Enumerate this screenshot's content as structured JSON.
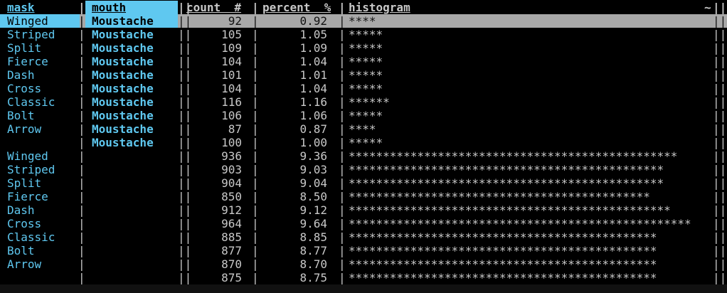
{
  "header": {
    "mask": "mask",
    "mouth": "mouth",
    "count": "count  #",
    "percent": "percent  %",
    "histogram": "histogram",
    "corner": "~"
  },
  "separator": "|",
  "rows": [
    {
      "mask": "Winged",
      "mouth": "Moustache",
      "count": "92",
      "percent": "0.92",
      "hist": "****"
    },
    {
      "mask": "Striped",
      "mouth": "Moustache",
      "count": "105",
      "percent": "1.05",
      "hist": "*****"
    },
    {
      "mask": "Split",
      "mouth": "Moustache",
      "count": "109",
      "percent": "1.09",
      "hist": "*****"
    },
    {
      "mask": "Fierce",
      "mouth": "Moustache",
      "count": "104",
      "percent": "1.04",
      "hist": "*****"
    },
    {
      "mask": "Dash",
      "mouth": "Moustache",
      "count": "101",
      "percent": "1.01",
      "hist": "*****"
    },
    {
      "mask": "Cross",
      "mouth": "Moustache",
      "count": "104",
      "percent": "1.04",
      "hist": "*****"
    },
    {
      "mask": "Classic",
      "mouth": "Moustache",
      "count": "116",
      "percent": "1.16",
      "hist": "******"
    },
    {
      "mask": "Bolt",
      "mouth": "Moustache",
      "count": "106",
      "percent": "1.06",
      "hist": "*****"
    },
    {
      "mask": "Arrow",
      "mouth": "Moustache",
      "count": "87",
      "percent": "0.87",
      "hist": "****"
    },
    {
      "mask": "",
      "mouth": "Moustache",
      "count": "100",
      "percent": "1.00",
      "hist": "*****"
    },
    {
      "mask": "Winged",
      "mouth": "",
      "count": "936",
      "percent": "9.36",
      "hist": "************************************************"
    },
    {
      "mask": "Striped",
      "mouth": "",
      "count": "903",
      "percent": "9.03",
      "hist": "**********************************************"
    },
    {
      "mask": "Split",
      "mouth": "",
      "count": "904",
      "percent": "9.04",
      "hist": "**********************************************"
    },
    {
      "mask": "Fierce",
      "mouth": "",
      "count": "850",
      "percent": "8.50",
      "hist": "********************************************"
    },
    {
      "mask": "Dash",
      "mouth": "",
      "count": "912",
      "percent": "9.12",
      "hist": "***********************************************"
    },
    {
      "mask": "Cross",
      "mouth": "",
      "count": "964",
      "percent": "9.64",
      "hist": "**************************************************"
    },
    {
      "mask": "Classic",
      "mouth": "",
      "count": "885",
      "percent": "8.85",
      "hist": "*********************************************"
    },
    {
      "mask": "Bolt",
      "mouth": "",
      "count": "877",
      "percent": "8.77",
      "hist": "*********************************************"
    },
    {
      "mask": "Arrow",
      "mouth": "",
      "count": "870",
      "percent": "8.70",
      "hist": "*********************************************"
    },
    {
      "mask": "",
      "mouth": "",
      "count": "875",
      "percent": "8.75",
      "hist": "*********************************************"
    }
  ],
  "colors": {
    "key_column": "#5fc8f0",
    "selected_row": "#a8a8a8",
    "background": "#000000"
  }
}
